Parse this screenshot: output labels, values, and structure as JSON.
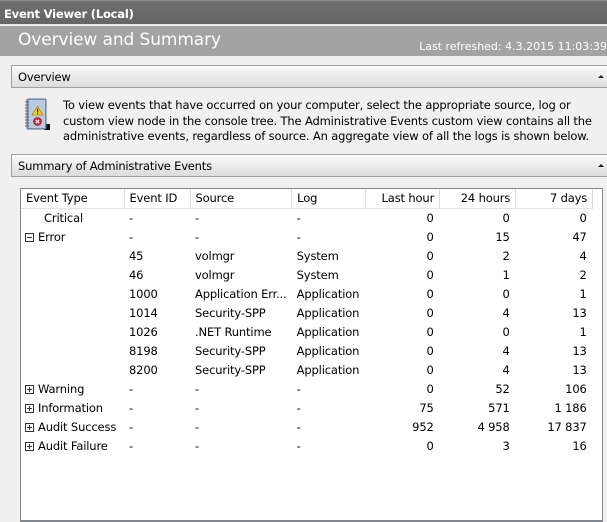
{
  "window": {
    "title": "Event Viewer (Local)"
  },
  "header": {
    "title": "Overview and Summary",
    "last_refreshed": "Last refreshed: 4.3.2015 11:03:39"
  },
  "overview": {
    "title": "Overview",
    "icon": "event-log-book-icon",
    "text": "To view events that have occurred on your computer, select the appropriate source, log or custom view node in the console tree. The Administrative Events custom view contains all the administrative events, regardless of source. An aggregate view of all the logs is shown below."
  },
  "summary": {
    "title": "Summary of Administrative Events",
    "columns": [
      "Event Type",
      "Event ID",
      "Source",
      "Log",
      "Last hour",
      "24 hours",
      "7 days"
    ],
    "rows": [
      {
        "type": "Critical",
        "toggle": "none",
        "level": 0,
        "event_id": "-",
        "source": "-",
        "log": "-",
        "last_hour": "0",
        "h24": "0",
        "d7": "0"
      },
      {
        "type": "Error",
        "toggle": "minus",
        "level": 0,
        "event_id": "-",
        "source": "-",
        "log": "-",
        "last_hour": "0",
        "h24": "15",
        "d7": "47"
      },
      {
        "type": "",
        "toggle": "child",
        "level": 1,
        "event_id": "45",
        "source": "volmgr",
        "log": "System",
        "last_hour": "0",
        "h24": "2",
        "d7": "4"
      },
      {
        "type": "",
        "toggle": "child",
        "level": 1,
        "event_id": "46",
        "source": "volmgr",
        "log": "System",
        "last_hour": "0",
        "h24": "1",
        "d7": "2"
      },
      {
        "type": "",
        "toggle": "child",
        "level": 1,
        "event_id": "1000",
        "source": "Application Err...",
        "log": "Application",
        "last_hour": "0",
        "h24": "0",
        "d7": "1"
      },
      {
        "type": "",
        "toggle": "child",
        "level": 1,
        "event_id": "1014",
        "source": "Security-SPP",
        "log": "Application",
        "last_hour": "0",
        "h24": "4",
        "d7": "13"
      },
      {
        "type": "",
        "toggle": "child",
        "level": 1,
        "event_id": "1026",
        "source": ".NET Runtime",
        "log": "Application",
        "last_hour": "0",
        "h24": "0",
        "d7": "1"
      },
      {
        "type": "",
        "toggle": "child",
        "level": 1,
        "event_id": "8198",
        "source": "Security-SPP",
        "log": "Application",
        "last_hour": "0",
        "h24": "4",
        "d7": "13"
      },
      {
        "type": "",
        "toggle": "child",
        "level": 1,
        "event_id": "8200",
        "source": "Security-SPP",
        "log": "Application",
        "last_hour": "0",
        "h24": "4",
        "d7": "13"
      },
      {
        "type": "Warning",
        "toggle": "plus",
        "level": 0,
        "event_id": "-",
        "source": "-",
        "log": "-",
        "last_hour": "0",
        "h24": "52",
        "d7": "106"
      },
      {
        "type": "Information",
        "toggle": "plus",
        "level": 0,
        "event_id": "-",
        "source": "-",
        "log": "-",
        "last_hour": "75",
        "h24": "571",
        "d7": "1 186"
      },
      {
        "type": "Audit Success",
        "toggle": "plus",
        "level": 0,
        "event_id": "-",
        "source": "-",
        "log": "-",
        "last_hour": "952",
        "h24": "4 958",
        "d7": "17 837"
      },
      {
        "type": "Audit Failure",
        "toggle": "plus",
        "level": 0,
        "event_id": "-",
        "source": "-",
        "log": "-",
        "last_hour": "0",
        "h24": "3",
        "d7": "16"
      }
    ]
  }
}
